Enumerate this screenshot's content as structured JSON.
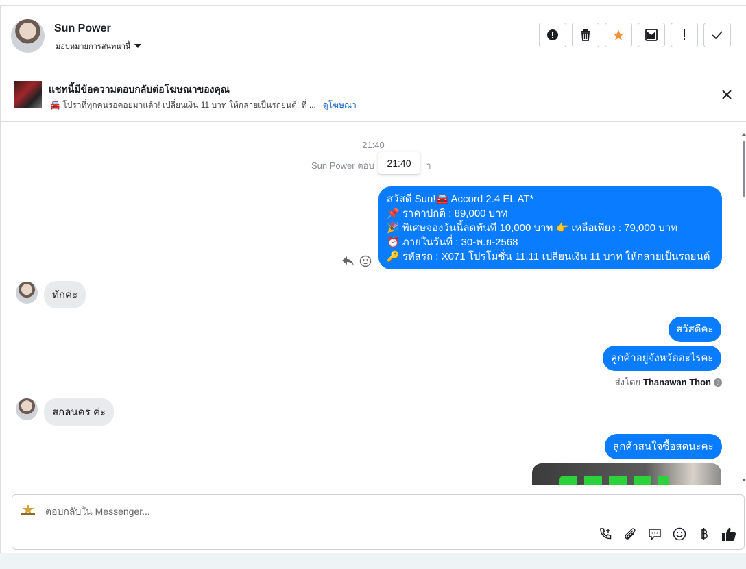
{
  "header": {
    "name": "Sun Power",
    "assign_label": "มอบหมายการสนทนานี้"
  },
  "ad_banner": {
    "title": "แชทนี้มีข้อความตอบกลับต่อโฆษณาของคุณ",
    "snippet": "🚘 โปราที่ทุกคนรอคอยมาแล้ว! เปลี่ยนเงิน 11 บาท ให้กลายเป็นรถยนต์! ที่ ...",
    "link": "ดูโฆษณา"
  },
  "chat": {
    "timestamp": "21:40",
    "reply_note": "Sun Power ตอบ",
    "reply_note_tail": "า",
    "tooltip": "21:40",
    "ad_message_lines": [
      "สวัสดี Sun!🚘 Accord 2.4 EL AT*",
      "📌 ราคาปกติ : 89,000 บาท",
      "🎉  พิเศษจองวันนี้ลดทันที 10,000 บาท 👉 เหลือเพียง : 79,000 บาท",
      "⏰ ภายในวันที่ : 30-พ.ย-2568",
      "🔑 รหัสรถ : X071 โปรโมชั่น 11.11 เปลี่ยนเงิน 11 บาท ให้กลายเป็นรถยนต์"
    ],
    "in_msg_1": "ทักค่ะ",
    "out_msg_1": "สวัสดีคะ",
    "out_msg_2": "ลูกค้าอยู่จังหวัดอะไรคะ",
    "sent_by_prefix": "ส่งโดย",
    "sent_by_name": "Thanawan Thon",
    "in_msg_2": "สกลนคร ค่ะ",
    "out_msg_3": "ลูกค้าสนใจซื้อสดนะคะ"
  },
  "composer": {
    "placeholder": "ตอบกลับใน Messenger..."
  },
  "colors": {
    "accent": "#0a7cff",
    "star": "#f7923b",
    "link": "#1264c6"
  }
}
